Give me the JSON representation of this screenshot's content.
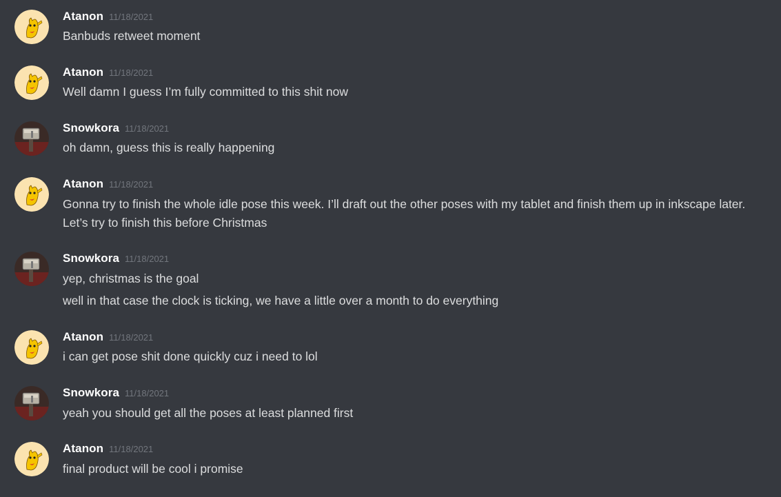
{
  "messages": [
    {
      "author": "Atanon",
      "avatar": "atanon",
      "timestamp": "11/18/2021",
      "lines": [
        "Banbuds retweet moment"
      ]
    },
    {
      "author": "Atanon",
      "avatar": "atanon",
      "timestamp": "11/18/2021",
      "lines": [
        "Well damn I guess I’m fully committed to this shit now"
      ]
    },
    {
      "author": "Snowkora",
      "avatar": "snowkora",
      "timestamp": "11/18/2021",
      "lines": [
        "oh damn, guess this is really happening"
      ]
    },
    {
      "author": "Atanon",
      "avatar": "atanon",
      "timestamp": "11/18/2021",
      "lines": [
        "Gonna try to finish the whole idle pose this week. I’ll draft out the other poses with my tablet and finish them up in inkscape later. Let’s try to finish this before Christmas"
      ]
    },
    {
      "author": "Snowkora",
      "avatar": "snowkora",
      "timestamp": "11/18/2021",
      "lines": [
        "yep, christmas is the goal",
        "well in that case the clock is ticking, we have a little over a month to do everything"
      ]
    },
    {
      "author": "Atanon",
      "avatar": "atanon",
      "timestamp": "11/18/2021",
      "lines": [
        "i can get pose shit done quickly cuz i need to lol"
      ]
    },
    {
      "author": "Snowkora",
      "avatar": "snowkora",
      "timestamp": "11/18/2021",
      "lines": [
        "yeah you should get all the poses at least planned first"
      ]
    },
    {
      "author": "Atanon",
      "avatar": "atanon",
      "timestamp": "11/18/2021",
      "lines": [
        "final product will be cool i promise"
      ]
    }
  ],
  "colors": {
    "background": "#36393f",
    "username": "#ffffff",
    "timestamp": "#72767d",
    "message_text": "#dcddde"
  }
}
